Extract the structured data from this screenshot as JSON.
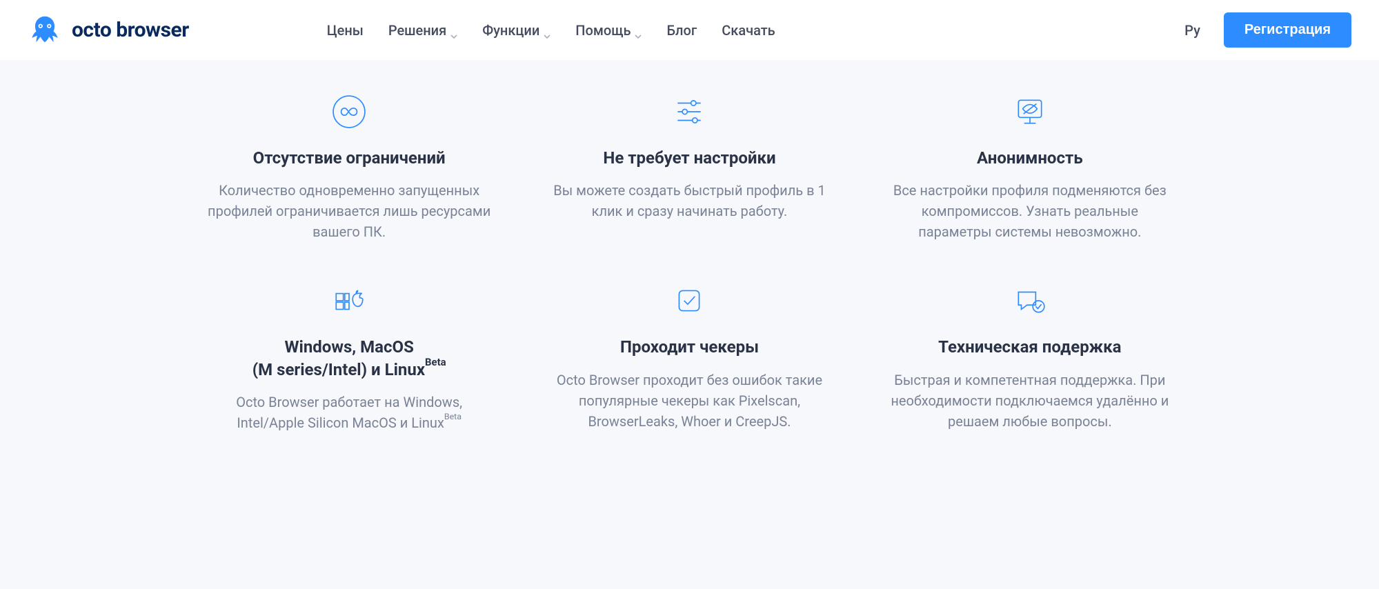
{
  "header": {
    "logo_text": "octo browser",
    "nav": [
      {
        "label": "Цены",
        "dropdown": false
      },
      {
        "label": "Решения",
        "dropdown": true
      },
      {
        "label": "Функции",
        "dropdown": true
      },
      {
        "label": "Помощь",
        "dropdown": true
      },
      {
        "label": "Блог",
        "dropdown": false
      },
      {
        "label": "Скачать",
        "dropdown": false
      }
    ],
    "lang_label": "Ру",
    "register_label": "Регистрация"
  },
  "features": [
    {
      "icon": "infinity-icon",
      "title": "Отсутствие ограничений",
      "desc": "Количество одновременно запущенных профилей ограничивается лишь ресурсами вашего ПК."
    },
    {
      "icon": "sliders-icon",
      "title": "Не требует настройки",
      "desc": "Вы можете создать быстрый профиль в 1 клик и сразу начинать работу."
    },
    {
      "icon": "anonymity-icon",
      "title": "Анонимность",
      "desc": "Все настройки профиля подменяются без компромиссов. Узнать реальные параметры системы невозможно."
    },
    {
      "icon": "os-icon",
      "title_html": "Windows, MacOS<br>(M series/Intel) и Linux<sup>Beta</sup>",
      "desc_html": "Octo Browser работает на Windows, Intel/Apple Silicon MacOS и Linux<sup>Beta</sup>"
    },
    {
      "icon": "check-icon",
      "title": "Проходит чекеры",
      "desc": "Octo Browser проходит без ошибок такие популярные чекеры как Pixelscan, BrowserLeaks, Whoer и CreepJS."
    },
    {
      "icon": "support-icon",
      "title": "Техническая подержка",
      "desc": "Быстрая и компетентная поддержка. При необходимости подключаемся удалённо и решаем любые вопросы."
    }
  ]
}
